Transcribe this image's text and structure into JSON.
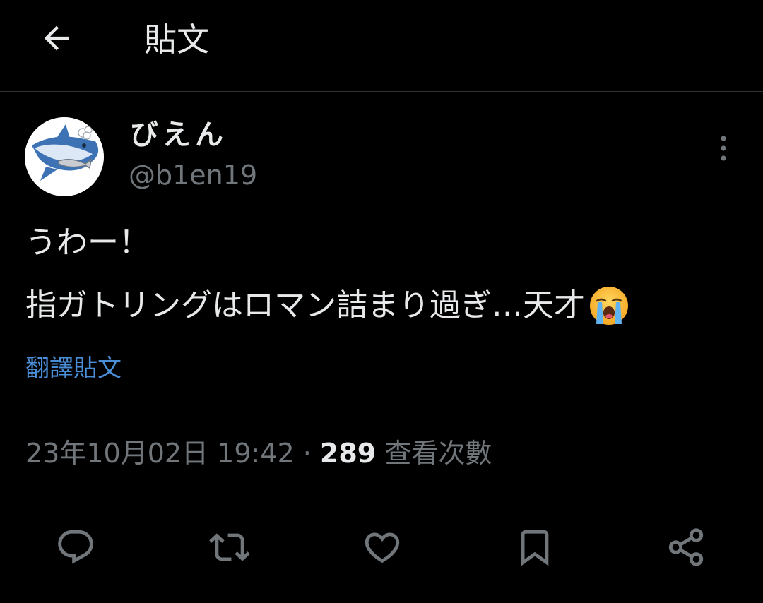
{
  "header": {
    "title": "貼文",
    "back_icon": "arrow-left-icon"
  },
  "tweet": {
    "author": {
      "display_name": "びえん",
      "handle": "@b1en19",
      "avatar_icon": "shark-avatar"
    },
    "text_line1": "うわー！",
    "text_line2": "指ガトリングはロマン詰まり過ぎ…天才",
    "emoji": "loudly-crying-face-emoji",
    "translate_label": "翻譯貼文",
    "timestamp": "23年10月02日 19:42",
    "separator": " · ",
    "view_count": "289",
    "view_label": " 查看次數"
  },
  "actions": [
    {
      "name": "reply",
      "icon": "reply-icon"
    },
    {
      "name": "retweet",
      "icon": "retweet-icon"
    },
    {
      "name": "like",
      "icon": "heart-icon"
    },
    {
      "name": "bookmark",
      "icon": "bookmark-icon"
    },
    {
      "name": "share",
      "icon": "share-icon"
    }
  ],
  "colors": {
    "background": "#000000",
    "text": "#e7e9ea",
    "muted": "#71767b",
    "link": "#4a8ed8",
    "divider": "#2f3336"
  }
}
